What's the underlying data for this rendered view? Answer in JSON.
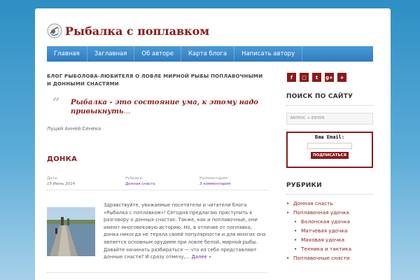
{
  "site": {
    "title": "Рыбалка с поплавком"
  },
  "nav": {
    "items": [
      "Главная",
      "Заглавная",
      "Об авторе",
      "Карта блога",
      "Написать автору"
    ]
  },
  "tagline": "Блог рыболова-любителя о ловле мирной рыбы поплавочными и донными снастями",
  "quote": {
    "bold": "Рыбалка - это состояние ума, к этому надо привыкнуть",
    "trail": "...",
    "author": "Луций Анней Сенека"
  },
  "post": {
    "title": "ДОНКА",
    "meta": {
      "date_label": "Дата:",
      "date": "15 Июнь 2014",
      "rubric_label": "Рубрика:",
      "rubric": "Донная снасть",
      "comments_label": "Комментарии:",
      "comments": "3 комментария"
    },
    "excerpt": "Здравствуйте, уважаемые посетители и читатели блога «Рыбалка с поплавком»! Сегодня предлагаю приступить к разговору о донных снастях. Также, как и поплавочные, они имеют многовековую историю. Но, в отличие от поплавка, донка никогда не теряла своей популярности и для многих она является основным орудием при ловле белой, мирной рыбы. Давайте начинать разбираться — что из себя представляют донные снасти? И сразу отмечу,…",
    "more": "Далее »"
  },
  "sidebar": {
    "social": [
      "f",
      "□",
      "t",
      "g+",
      "+"
    ],
    "search_title": "ПОИСК ПО САЙТУ",
    "search_placeholder": "ЗАПРОС + ENTER",
    "subscribe": {
      "label": "Ваш Email:",
      "button": "ПОДПИСАТЬСЯ"
    },
    "rubrics_title": "РУБРИКИ",
    "rubrics": [
      {
        "label": "Донная снасть",
        "level": 0
      },
      {
        "label": "Поплавочная удочка",
        "level": 0
      },
      {
        "label": "Болонская удочка",
        "level": 1
      },
      {
        "label": "Матчевая удочка",
        "level": 1
      },
      {
        "label": "Маховая удочка",
        "level": 1
      },
      {
        "label": "Техника и тактика",
        "level": 1
      },
      {
        "label": "Поплавочные снасти",
        "level": 0
      }
    ]
  },
  "colors": {
    "brand": "#8b1a1a",
    "nav": "#3a88c9",
    "link": "#6a2fa0"
  }
}
